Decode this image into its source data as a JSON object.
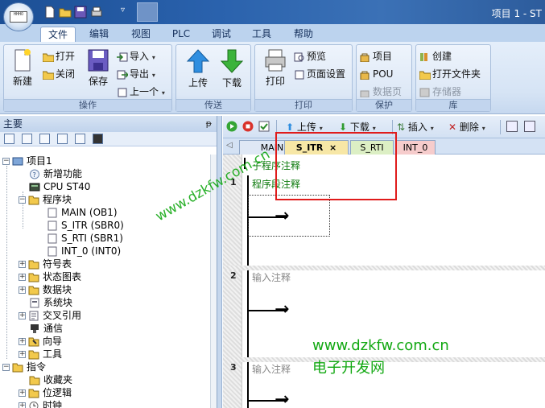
{
  "window": {
    "title": "项目 1 - ST"
  },
  "app_logo_text": "HHHO",
  "quick_access": [
    "new-icon",
    "open-icon",
    "save-icon",
    "print-icon"
  ],
  "ribbon_tabs": [
    "文件",
    "编辑",
    "视图",
    "PLC",
    "调试",
    "工具",
    "帮助"
  ],
  "ribbon": {
    "groups": [
      {
        "label": "操作",
        "items": {
          "new": "新建",
          "open": "打开",
          "close": "关闭",
          "save": "保存",
          "import": "导入",
          "export": "导出",
          "previous": "上一个"
        }
      },
      {
        "label": "传送",
        "items": {
          "upload": "上传",
          "download": "下载"
        }
      },
      {
        "label": "打印",
        "items": {
          "print": "打印",
          "preview": "预览",
          "page_setup": "页面设置"
        }
      },
      {
        "label": "保护",
        "items": {
          "project": "项目",
          "pou": "POU",
          "data_page": "数据页"
        }
      },
      {
        "label": "库",
        "items": {
          "create": "创建",
          "open_folder": "打开文件夹",
          "memory": "存储器"
        }
      }
    ]
  },
  "left_panel": {
    "title": "主要",
    "pin": "ᵽ",
    "tree": [
      {
        "label": "项目1"
      },
      {
        "label": "新增功能"
      },
      {
        "label": "CPU ST40"
      },
      {
        "label": "程序块"
      },
      {
        "label": "MAIN (OB1)"
      },
      {
        "label": "S_ITR (SBR0)"
      },
      {
        "label": "S_RTI (SBR1)"
      },
      {
        "label": "INT_0 (INT0)"
      },
      {
        "label": "符号表"
      },
      {
        "label": "状态图表"
      },
      {
        "label": "数据块"
      },
      {
        "label": "系统块"
      },
      {
        "label": "交叉引用"
      },
      {
        "label": "通信"
      },
      {
        "label": "向导"
      },
      {
        "label": "工具"
      },
      {
        "label": "指令"
      },
      {
        "label": "收藏夹"
      },
      {
        "label": "位逻辑"
      },
      {
        "label": "时钟"
      }
    ]
  },
  "editor": {
    "toolbar": {
      "upload": "上传",
      "download": "下载",
      "insert": "插入",
      "delete": "删除"
    },
    "tabs": [
      {
        "label": "MAIN",
        "color": "#dfe8f5"
      },
      {
        "label": "S_ITR",
        "color": "#f7e7a6",
        "active": true,
        "close": "×"
      },
      {
        "label": "S_RTI",
        "color": "#dcefc4"
      },
      {
        "label": "INT_0",
        "color": "#f6cccc"
      }
    ],
    "subroutine_comment": "子程序注释",
    "rungs": [
      {
        "number": "1",
        "comment": "程序段注释"
      },
      {
        "number": "2",
        "comment": "输入注释"
      },
      {
        "number": "3",
        "comment": "输入注释"
      }
    ],
    "coil_symbol": "→"
  },
  "watermarks": {
    "url_diagonal": "www.dzkfw.com.cn",
    "url": "www.dzkfw.com.cn",
    "name": "电子开发网"
  }
}
